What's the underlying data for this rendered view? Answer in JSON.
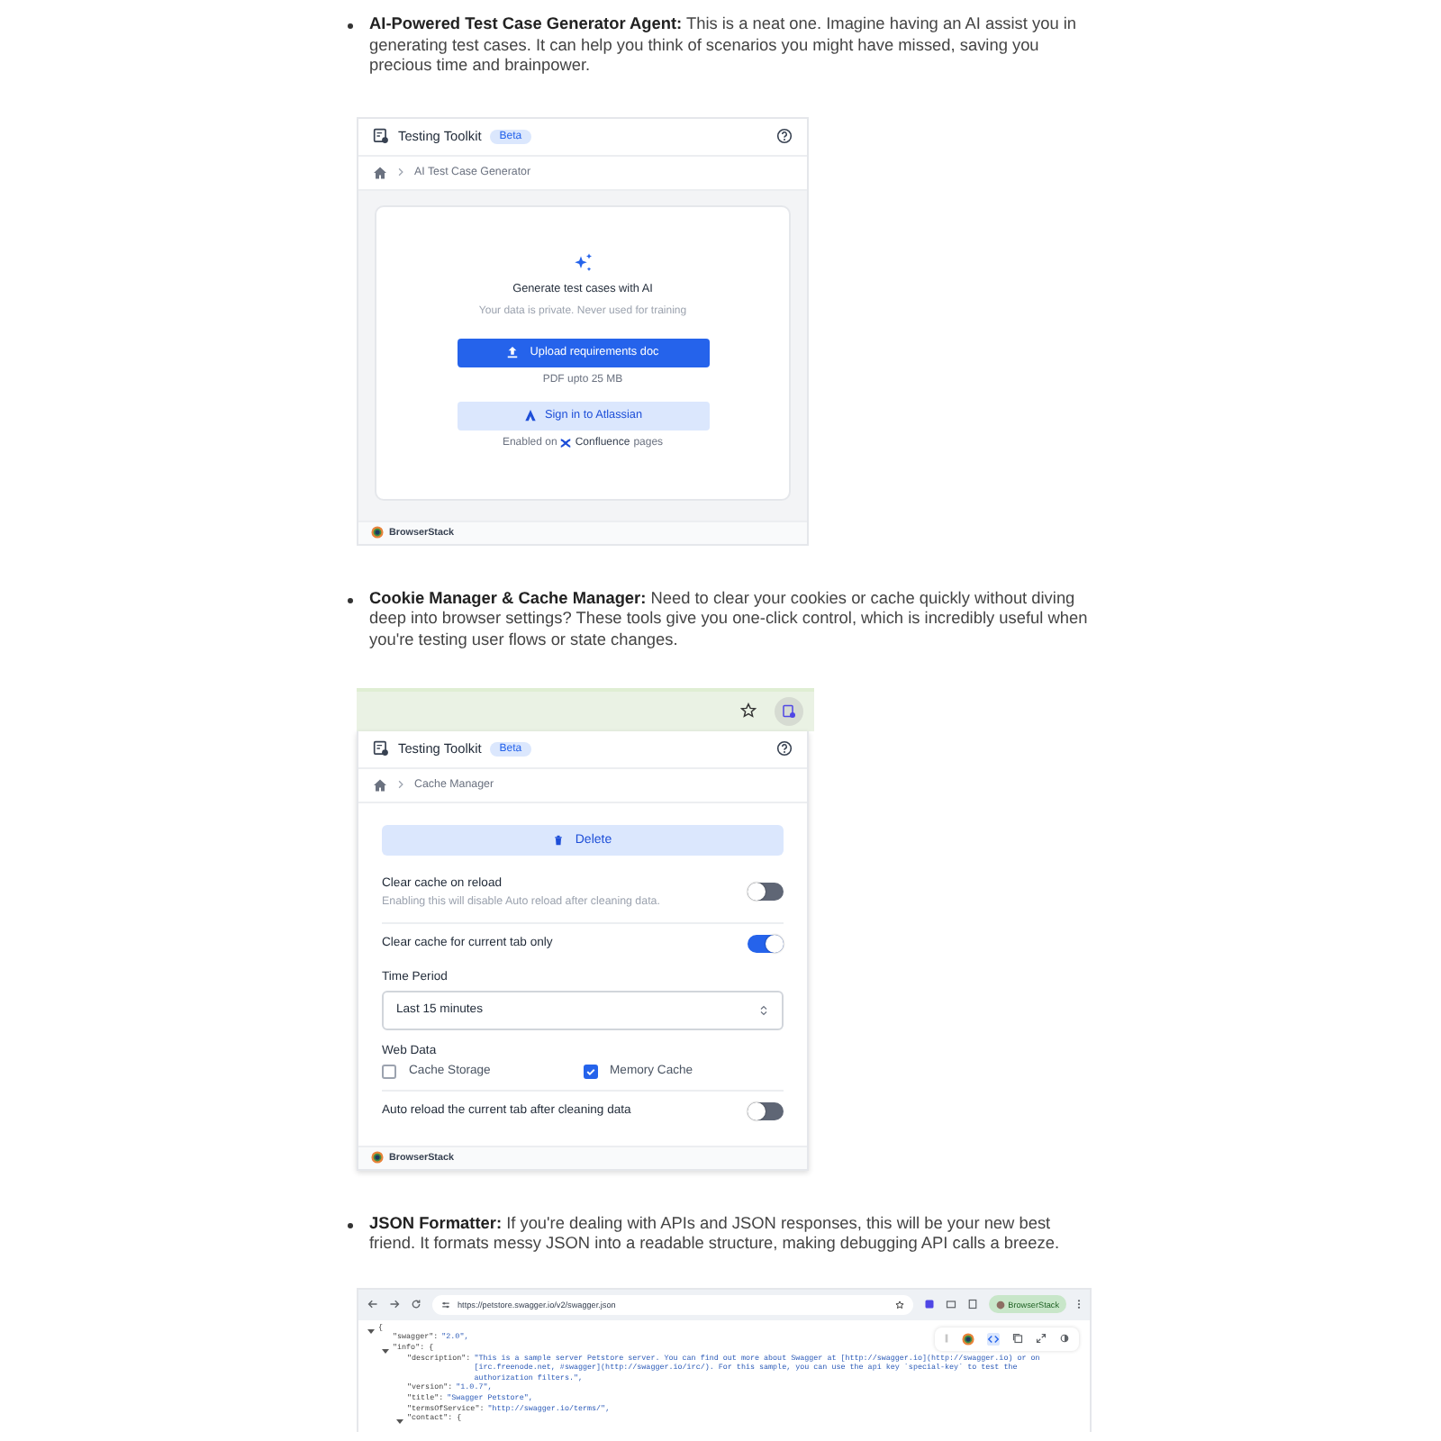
{
  "article": {
    "items": [
      {
        "text": "**AI-Powered Test Case Generator Agent:** This is a neat one. Imagine having an AI assist you in generating test cases. It can help you think of scenarios you might have missed, saving you precious time and brainpower.",
        "screenshot": {
          "kind": "generator",
          "app_title": "Testing Toolkit",
          "badge": "Beta",
          "breadcrumb": "AI Test Case Generator",
          "heading": "Generate test cases with AI",
          "subtext": "Your data is private. Never used for training",
          "upload_button": "Upload requirements doc",
          "upload_hint": "PDF upto 25 MB",
          "signin_button": "Sign in to Atlassian",
          "enabled_prefix": "Enabled on",
          "enabled_product": "Confluence",
          "enabled_suffix": "pages",
          "footer": "BrowserStack"
        }
      },
      {
        "text": "**Cookie Manager & Cache Manager:** Need to clear your cookies or cache quickly without diving deep into browser settings? These tools give you one-click control, which is incredibly useful when you're testing user flows or state changes.",
        "screenshot": {
          "kind": "cache_manager",
          "app_title": "Testing Toolkit",
          "badge": "Beta",
          "breadcrumb": "Cache Manager",
          "delete_button": "Delete",
          "settings": [
            {
              "kind": "toggle",
              "label": "Clear cache on reload",
              "description": "Enabling this will disable Auto reload after cleaning data.",
              "on": false
            },
            {
              "kind": "toggle",
              "label": "Clear cache for current tab only",
              "on": true
            },
            {
              "kind": "select",
              "label": "Time Period",
              "value": "Last 15 minutes"
            },
            {
              "kind": "checkboxes",
              "label": "Web Data",
              "options": [
                {
                  "label": "Cache Storage",
                  "checked": false
                },
                {
                  "label": "Memory Cache",
                  "checked": true
                }
              ]
            },
            {
              "kind": "toggle",
              "label": "Auto reload the current tab after cleaning data",
              "on": false
            }
          ],
          "footer": "BrowserStack"
        }
      },
      {
        "text": "**JSON Formatter:** If you're dealing with APIs and JSON responses, this will be your new best friend. It formats messy JSON into a readable structure, making debugging API calls a breeze.",
        "screenshot": {
          "kind": "json_viewer",
          "url": "https://petstore.swagger.io/v2/swagger.json",
          "profile_button": "BrowserStack",
          "tree": [
            {
              "text": "{",
              "expanded": true,
              "children": [
                {
                  "key": "\"swagger\":",
                  "value": "\"2.0\","
                },
                {
                  "text": "\"info\": {",
                  "expanded": true,
                  "children": [
                    {
                      "key": "\"description\":",
                      "value": "\"This is a sample server Petstore server. You can find out more about Swagger at [http://swagger.io](http://swagger.io) or on [irc.freenode.net, #swagger](http://swagger.io/irc/). For this sample, you can use the api key `special-key` to test the authorization filters.\","
                    },
                    {
                      "key": "\"version\":",
                      "value": "\"1.0.7\","
                    },
                    {
                      "key": "\"title\":",
                      "value": "\"Swagger Petstore\","
                    },
                    {
                      "key": "\"termsOfService\":",
                      "value": "\"http://swagger.io/terms/\","
                    },
                    {
                      "text": "\"contact\": {",
                      "expanded": true
                    }
                  ]
                }
              ]
            }
          ]
        }
      }
    ]
  }
}
